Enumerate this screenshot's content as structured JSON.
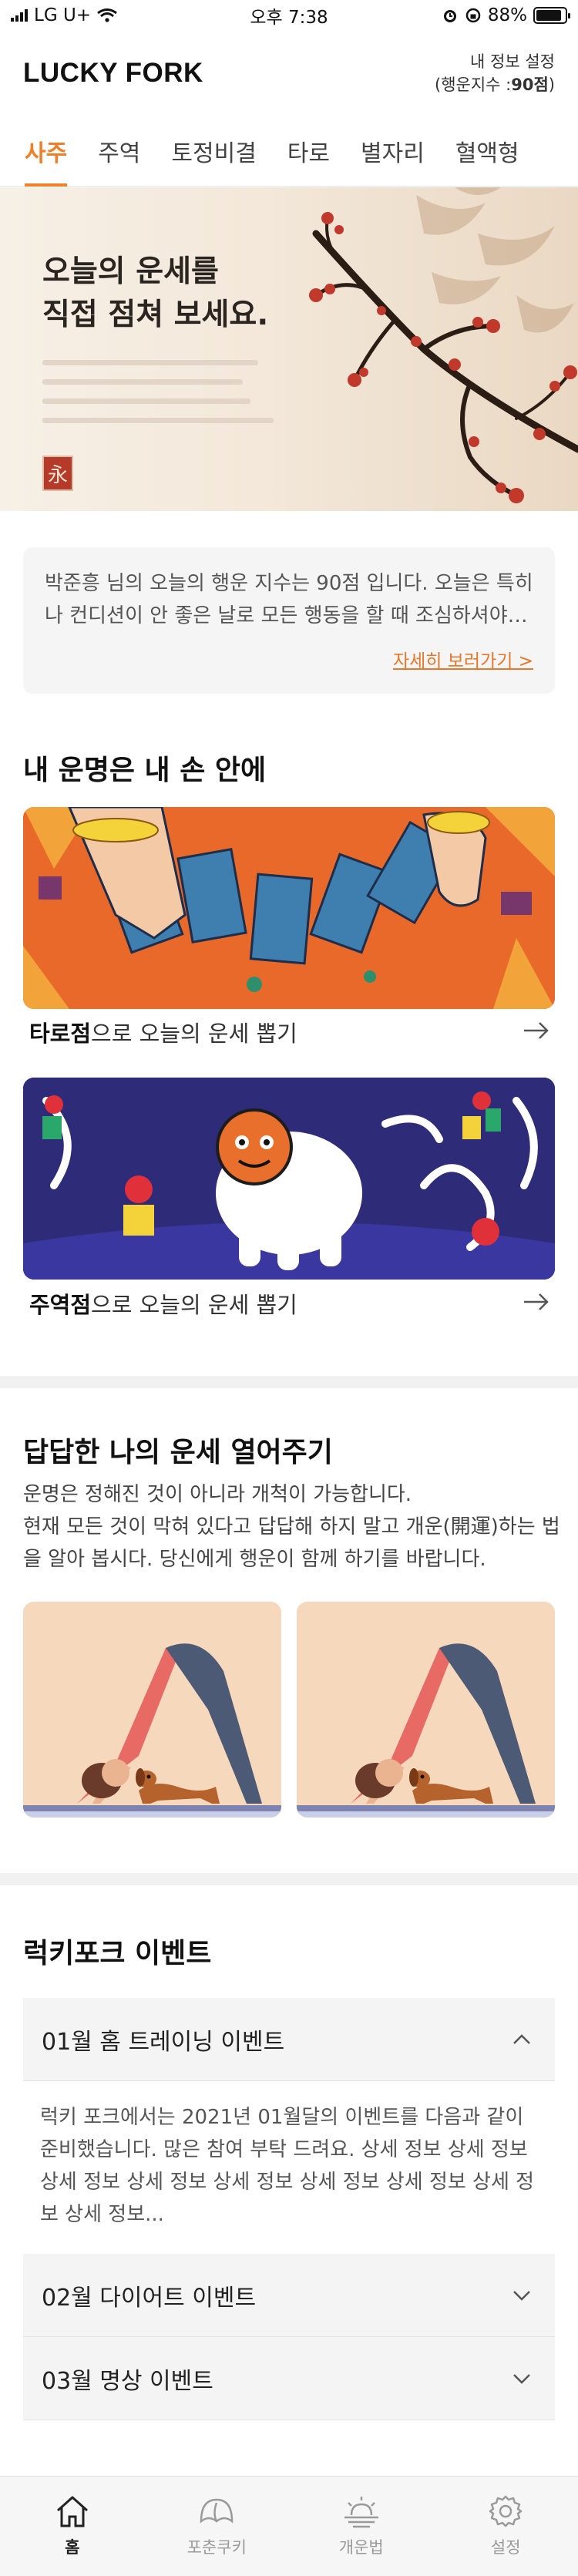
{
  "status_bar": {
    "carrier": "LG U+",
    "time": "오후 7:38",
    "battery": "88%",
    "battery_level": 0.88
  },
  "header": {
    "logo": "LUCKY FORK",
    "settings_link": "내 정보 설정",
    "score_prefix": "(행운지수 : ",
    "score_value": "90점",
    "score_suffix": ")"
  },
  "tabs": [
    {
      "label": "사주",
      "active": true
    },
    {
      "label": "주역",
      "active": false
    },
    {
      "label": "토정비결",
      "active": false
    },
    {
      "label": "타로",
      "active": false
    },
    {
      "label": "별자리",
      "active": false
    },
    {
      "label": "혈액형",
      "active": false
    }
  ],
  "hero": {
    "title": "오늘의 운세를\n직접 점쳐 보세요.",
    "seal": "永"
  },
  "fortune": {
    "text": "박준흥 님의 오늘의 행운 지수는 90점 입니다. 오늘은 특히 나 컨디션이 안 좋은 날로 모든 행동을 할 때 조심하셔야 합니다.",
    "more_link": "자세히 보러가기 >"
  },
  "fate_section": {
    "title": "내 운명은 내 손 안에",
    "items": [
      {
        "bold": "타로점",
        "rest": "으로 오늘의 운세 뽑기"
      },
      {
        "bold": "주역점",
        "rest": "으로 오늘의 운세 뽑기"
      }
    ]
  },
  "open_section": {
    "title": "답답한 나의 운세 열어주기",
    "description": "운명은 정해진 것이 아니라 개척이 가능합니다.\n현재 모든 것이 막혀 있다고 답답해 하지 말고 개운(開運)하는 법을 알아 봅시다. 당신에게 행운이 함께 하기를 바랍니다."
  },
  "events": {
    "title": "럭키포크 이벤트",
    "items": [
      {
        "title": "01월 홈 트레이닝 이벤트",
        "expanded": true,
        "body": "럭키 포크에서는 2021년 01월달의 이벤트를 다음과 같이 준비했습니다. 많은 참여 부탁 드려요. 상세 정보 상세 정보 상세 정보 상세 정보 상세 정보 상세 정보 상세 정보 상세 정보 상세 정보..."
      },
      {
        "title": "02월 다이어트 이벤트",
        "expanded": false
      },
      {
        "title": "03월 명상 이벤트",
        "expanded": false
      }
    ]
  },
  "bottom_nav": [
    {
      "label": "홈",
      "icon": "home-icon",
      "active": true
    },
    {
      "label": "포춘쿠키",
      "icon": "fortune-cookie-icon",
      "active": false
    },
    {
      "label": "개운법",
      "icon": "sunrise-icon",
      "active": false
    },
    {
      "label": "설정",
      "icon": "gear-icon",
      "active": false
    }
  ],
  "colors": {
    "accent": "#f07f29",
    "tarot_bg": "#e8692a",
    "juyeok_bg": "#2e2b78",
    "yoga_bg": "#f6d8bc"
  }
}
